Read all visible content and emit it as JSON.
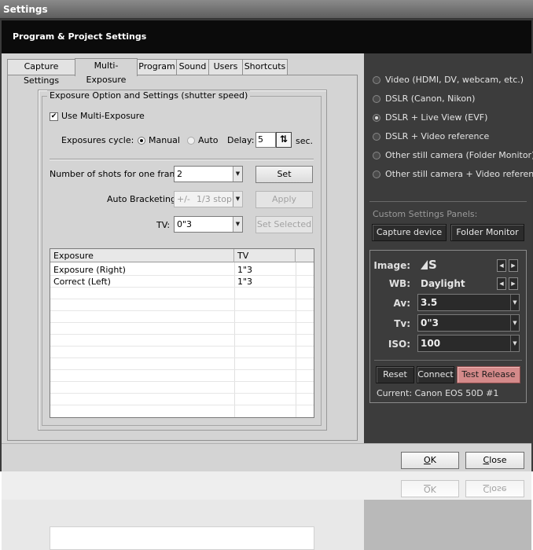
{
  "window": {
    "title": "Settings",
    "header": "Program & Project Settings"
  },
  "tabs": [
    {
      "label": "Capture Settings",
      "active": false
    },
    {
      "label": "Multi-Exposure",
      "active": true
    },
    {
      "label": "Program",
      "active": false
    },
    {
      "label": "Sound",
      "active": false
    },
    {
      "label": "Users",
      "active": false
    },
    {
      "label": "Shortcuts",
      "active": false
    }
  ],
  "exposure_group": {
    "title": "Exposure Option and Settings (shutter speed)",
    "use_multi_exposure": {
      "label": "Use Multi-Exposure",
      "checked": "✔"
    },
    "cycle_label": "Exposures cycle:",
    "manual_label": "Manual",
    "auto_label": "Auto",
    "delay_label": "Delay:",
    "delay_value": "5",
    "sec_label": "sec.",
    "shots_label": "Number of shots for one frame:",
    "shots_value": "2",
    "set_button": "Set",
    "bracket_label": "Auto Bracketing:",
    "bracket_prefix": "+/-",
    "bracket_value": "1/3 stop",
    "apply_button": "Apply",
    "tv_label": "TV:",
    "tv_value": "0\"3",
    "set_selected_button": "Set Selected"
  },
  "exposure_table": {
    "headers": [
      "Exposure",
      "TV"
    ],
    "rows": [
      {
        "exposure": "Exposure (Right)",
        "tv": "1\"3"
      },
      {
        "exposure": "Correct (Left)",
        "tv": "1\"3"
      }
    ]
  },
  "capture_sources": {
    "options": [
      {
        "label": "Video (HDMI, DV, webcam, etc.)",
        "selected": false
      },
      {
        "label": "DSLR (Canon, Nikon)",
        "selected": false
      },
      {
        "label": "DSLR + Live View (EVF)",
        "selected": true
      },
      {
        "label": "DSLR + Video reference",
        "selected": false
      },
      {
        "label": "Other still camera (Folder Monitor)",
        "selected": false
      },
      {
        "label": "Other still camera + Video reference",
        "selected": false
      }
    ],
    "custom_panels_label": "Custom Settings Panels:",
    "capture_device_button": "Capture device",
    "folder_monitor_button": "Folder Monitor"
  },
  "camera": {
    "image_label": "Image:",
    "image_value": "S",
    "wb_label": "WB:",
    "wb_value": "Daylight",
    "av_label": "Av:",
    "av_value": "3.5",
    "tv_label": "Tv:",
    "tv_value": "0\"3",
    "iso_label": "ISO:",
    "iso_value": "100",
    "reset_button": "Reset",
    "connect_button": "Connect",
    "test_release_button": "Test Release",
    "current_text": "Current: Canon EOS 50D #1"
  },
  "footer": {
    "ok_prefix": "",
    "ok_underlined": "O",
    "ok_rest": "K",
    "close_underlined": "C",
    "close_rest": "lose"
  },
  "colors": {
    "header_bg": "#0b0b0b",
    "panel_bg": "#d4d4d4",
    "dark_panel_bg": "#3c3c3c",
    "test_release_bg": "#d48a8a"
  },
  "icons": {
    "checkbox": "check-mark",
    "spin": "up-down-arrows-icon",
    "image_quality": "jpeg-quality-icon",
    "combo": "chevron-down-icon"
  }
}
